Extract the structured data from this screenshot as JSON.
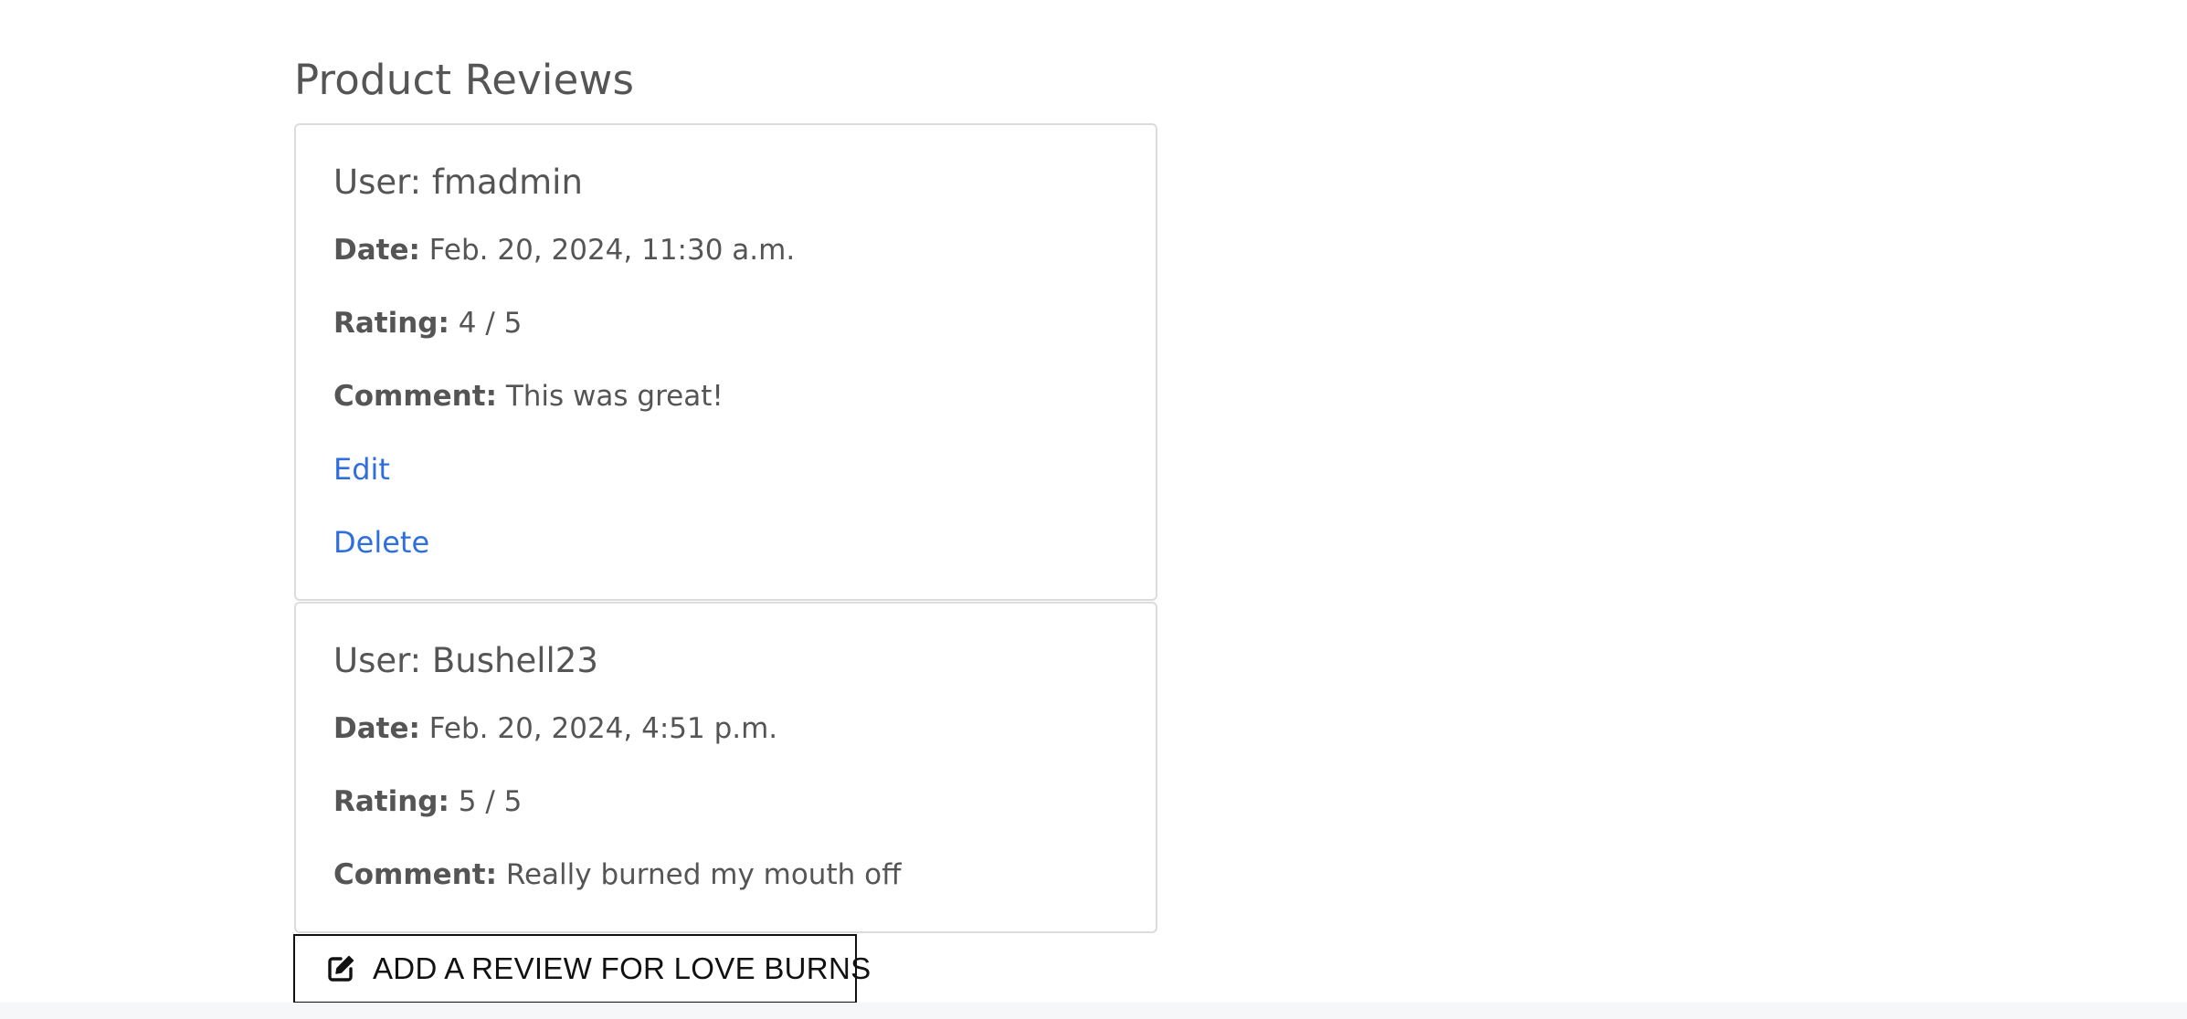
{
  "section": {
    "title": "Product Reviews"
  },
  "labels": {
    "date": "Date:",
    "rating": "Rating:",
    "comment": "Comment:"
  },
  "reviews": [
    {
      "user": "User: fmadmin",
      "date": "Feb. 20, 2024, 11:30 a.m.",
      "rating": "4 / 5",
      "comment": "This was great!",
      "edit_label": "Edit",
      "delete_label": "Delete"
    },
    {
      "user": "User: Bushell23",
      "date": "Feb. 20, 2024, 4:51 p.m.",
      "rating": "5 / 5",
      "comment": "Really burned my mouth off"
    }
  ],
  "add_review_button": {
    "label": "ADD A REVIEW FOR LOVE BURNS",
    "icon": "edit-icon"
  },
  "colors": {
    "text": "#555555",
    "link": "#2f6fdd",
    "card_border": "#dcdcdc",
    "button_border": "#111111",
    "footer": "#f6f7f9"
  }
}
